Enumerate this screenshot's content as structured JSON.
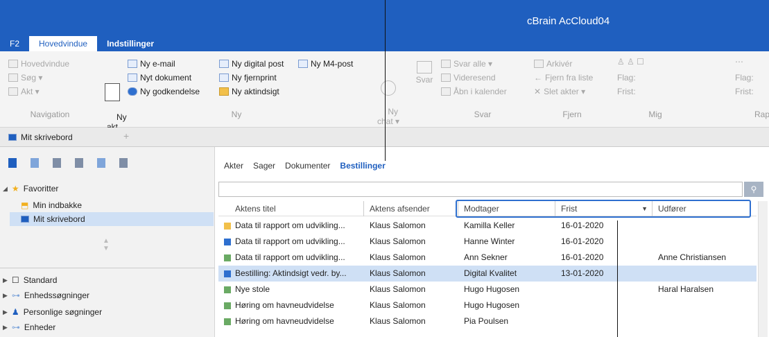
{
  "window": {
    "title": "cBrain AcCloud04"
  },
  "ribbon_tabs": [
    {
      "label": "F2"
    },
    {
      "label": "Hovedvindue"
    },
    {
      "label": "Indstillinger"
    }
  ],
  "ribbon": {
    "navigation": {
      "items": [
        "Hovedvindue",
        "Søg ▾",
        "Akt ▾"
      ],
      "label": "Navigation"
    },
    "ny": {
      "big_button": "Ny\nakt",
      "col1": [
        "Ny e-mail",
        "Nyt dokument",
        "Ny godkendelse"
      ],
      "col2": [
        "Ny digital post",
        "Ny fjernprint",
        "Ny aktindsigt"
      ],
      "col3": [
        "Ny M4-post"
      ],
      "label": "Ny"
    },
    "chat": {
      "label": "Ny\nchat ▾"
    },
    "svar": {
      "big": "Svar",
      "items": [
        "Svar alle ▾",
        "Videresend",
        "Åbn i kalender"
      ],
      "label": "Svar"
    },
    "fjern": {
      "items": [
        "Arkivér",
        "Fjern fra liste",
        "Slet akter ▾"
      ],
      "label": "Fjern"
    },
    "mig": {
      "items": [
        "Flag:",
        "Frist:"
      ],
      "label": "Mig"
    },
    "rap": {
      "items": [
        "Flag:",
        "Frist:"
      ],
      "label": "Rap"
    }
  },
  "doc_tab": {
    "label": "Mit skrivebord",
    "icon": "desktop-icon"
  },
  "sidebar": {
    "favorites": "Favoritter",
    "inbox": "Min indbakke",
    "desk": "Mit skrivebord",
    "standard": "Standard",
    "unit_search": "Enhedssøgninger",
    "personal_search": "Personlige søgninger",
    "units": "Enheder"
  },
  "subtabs": [
    "Akter",
    "Sager",
    "Dokumenter",
    "Bestillinger"
  ],
  "search": {
    "placeholder": ""
  },
  "columns": [
    "Aktens titel",
    "Aktens afsender",
    "Modtager",
    "Frist",
    "Udfører"
  ],
  "rows": [
    {
      "icon_color": "#f2c04a",
      "title": "Data til rapport om udvikling...",
      "sender": "Klaus Salomon",
      "receiver": "Kamilla Keller",
      "due": "16-01-2020",
      "performer": ""
    },
    {
      "icon_color": "#2e6fcf",
      "title": "Data til rapport om udvikling...",
      "sender": "Klaus Salomon",
      "receiver": "Hanne Winter",
      "due": "16-01-2020",
      "performer": ""
    },
    {
      "icon_color": "#6aaa64",
      "title": "Data til rapport om udvikling...",
      "sender": "Klaus Salomon",
      "receiver": "Ann Sekner",
      "due": "16-01-2020",
      "performer": "Anne Christiansen"
    },
    {
      "icon_color": "#2e6fcf",
      "title": "Bestilling: Aktindsigt vedr. by...",
      "sender": "Klaus Salomon",
      "receiver": "Digital Kvalitet",
      "due": "13-01-2020",
      "performer": ""
    },
    {
      "icon_color": "#6aaa64",
      "title": "Nye stole",
      "sender": "Klaus Salomon",
      "receiver": "Hugo Hugosen",
      "due": "",
      "performer": "Haral Haralsen"
    },
    {
      "icon_color": "#6aaa64",
      "title": "Høring om havneudvidelse",
      "sender": "Klaus Salomon",
      "receiver": "Hugo Hugosen",
      "due": "",
      "performer": ""
    },
    {
      "icon_color": "#6aaa64",
      "title": "Høring om havneudvidelse",
      "sender": "Klaus Salomon",
      "receiver": "Pia Poulsen",
      "due": "",
      "performer": ""
    }
  ],
  "selected_row": 3
}
